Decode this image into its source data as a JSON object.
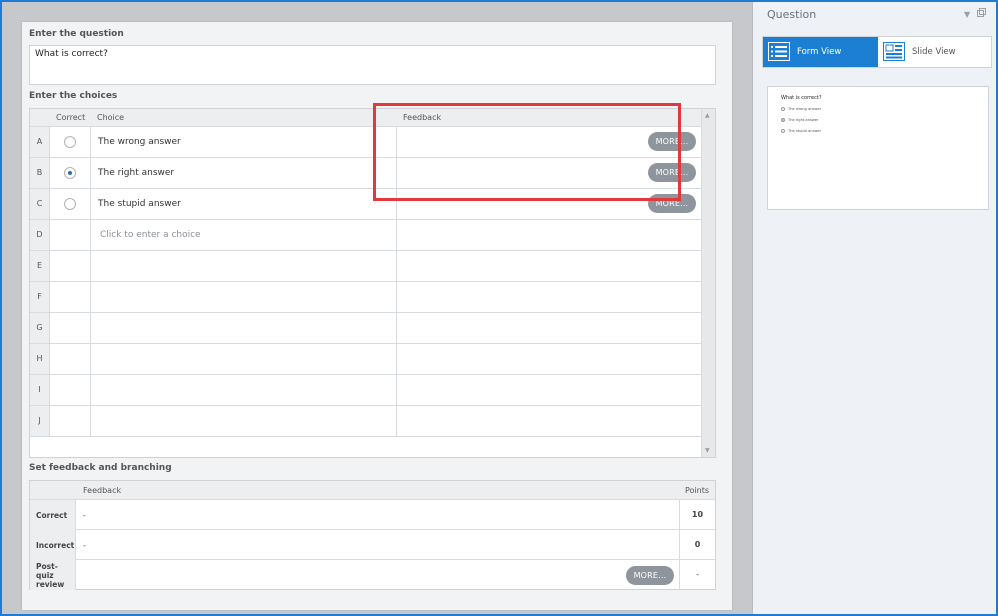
{
  "panel": {
    "title": "Question",
    "tabs": [
      {
        "label": "Form View",
        "active": true,
        "icon": "form-view-icon"
      },
      {
        "label": "Slide View",
        "active": false,
        "icon": "slide-view-icon"
      }
    ],
    "preview": {
      "question": "What is correct?",
      "options": [
        {
          "label": "The wrong answer",
          "selected": false
        },
        {
          "label": "The right answer",
          "selected": true
        },
        {
          "label": "The stupid answer",
          "selected": false
        }
      ]
    }
  },
  "form": {
    "question_label": "Enter the question",
    "question_value": "What is correct?",
    "choices_label": "Enter the choices",
    "choices_headers": {
      "correct": "Correct",
      "choice": "Choice",
      "feedback": "Feedback"
    },
    "choices": [
      {
        "letter": "A",
        "text": "The wrong answer",
        "correct": false,
        "more": "MORE..."
      },
      {
        "letter": "B",
        "text": "The right answer",
        "correct": true,
        "more": "MORE..."
      },
      {
        "letter": "C",
        "text": "The stupid answer",
        "correct": false,
        "more": "MORE..."
      },
      {
        "letter": "D",
        "placeholder": "Click to enter a choice"
      },
      {
        "letter": "E"
      },
      {
        "letter": "F"
      },
      {
        "letter": "G"
      },
      {
        "letter": "H"
      },
      {
        "letter": "I"
      },
      {
        "letter": "J"
      }
    ],
    "feedback_label": "Set feedback and branching",
    "feedback_headers": {
      "feedback": "Feedback",
      "points": "Points"
    },
    "feedback_rows": [
      {
        "label": "Correct",
        "text": "-",
        "points": "10"
      },
      {
        "label": "Incorrect",
        "text": "-",
        "points": "0"
      },
      {
        "label": "Post-quiz review",
        "more": "MORE...",
        "points": "-"
      }
    ]
  },
  "colors": {
    "accent": "#1c7fd4",
    "highlight": "#e2393c",
    "button": "#8e959c"
  }
}
